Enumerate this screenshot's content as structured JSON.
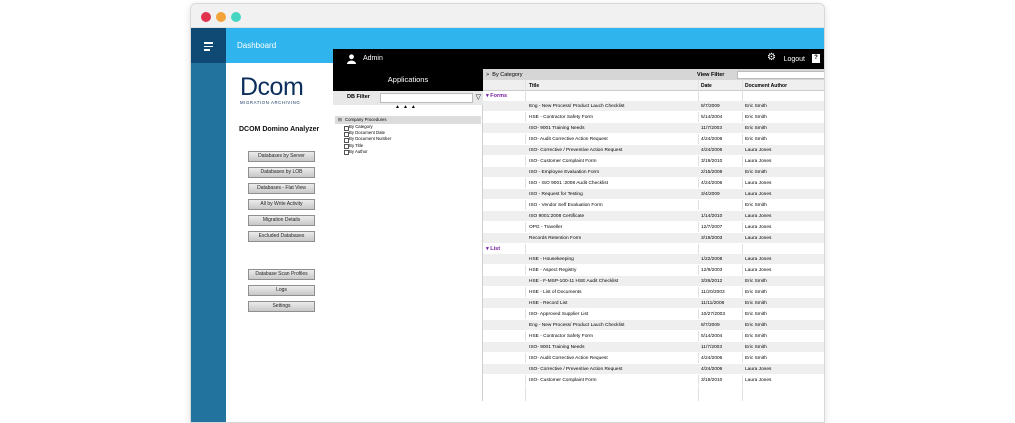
{
  "window": {
    "dots": [
      "#e0334d",
      "#f2a33a",
      "#47d6c1"
    ]
  },
  "topbar": {
    "title": "Dashboard"
  },
  "brand": {
    "logo_text": "Dcom",
    "logo_sub": "MIGRATION ARCHIVING",
    "app_title": "DCOM Domino Analyzer"
  },
  "nav": {
    "group1": [
      "Databases by Server",
      "Databases by LOB",
      "Databases - Flat View",
      "All by Write Activity",
      "Migration Details",
      "Excluded Databases"
    ],
    "group2": [
      "Database Scan Profiles",
      "Logs",
      "Settings"
    ]
  },
  "header": {
    "user": "Admin",
    "logout": "Logout",
    "help": "?"
  },
  "applications": {
    "title": "Applications",
    "db_filter_label": "DB Filter",
    "tree_root": "Company Procedures",
    "tree_items": [
      "By Category",
      "By Document Date",
      "By Document Number",
      "By Title",
      "By Author"
    ]
  },
  "view": {
    "breadcrumb": "By Category",
    "view_filter_label": "View Filter",
    "columns": {
      "title": "Title",
      "date": "Date",
      "author": "Document Author"
    },
    "categories": [
      {
        "name": "Forms",
        "rows": [
          [
            "Eng - New Process/ Product Lauch Checklist",
            "8/7/2009",
            "Eric Smith"
          ],
          [
            "HSE - Contractor Safety Form",
            "5/14/2004",
            "Eric Smith"
          ],
          [
            "ISO- 9001 Training Needs",
            "11/7/2003",
            "Eric Smith"
          ],
          [
            "ISO- Audit Corrective Action Request",
            "4/24/2006",
            "Eric Smith"
          ],
          [
            "ISO- Corrective / Preventive Action Request",
            "4/24/2006",
            "Laura Jones"
          ],
          [
            "ISO- Customer Complaint Form",
            "3/19/2010",
            "Laura Jones"
          ],
          [
            "ISO - Employee Evaluation Form",
            "2/15/2008",
            "Eric Smith"
          ],
          [
            "ISO - ISO 9001 :2008 Audit Checklist",
            "4/24/2006",
            "Laura Jones"
          ],
          [
            "ISO - Request for Testing",
            "3/4/2009",
            "Laura Jones"
          ],
          [
            "ISO - Vendor Self Evaluation Form",
            "",
            "Eric Smith"
          ],
          [
            "ISO 9001:2008 Certificate",
            "1/14/2010",
            "Laura Jones"
          ],
          [
            "OPG - Traveller",
            "12/7/2007",
            "Laura Jones"
          ],
          [
            "Records Retention Form",
            "3/19/2003",
            "Laura Jones"
          ]
        ]
      },
      {
        "name": "List",
        "rows": [
          [
            "HSE - Housekeeping",
            "1/22/2008",
            "Laura Jones"
          ],
          [
            "HSE - Aspect Registry",
            "12/9/2003",
            "Laura Jones"
          ],
          [
            "HSE - F-MSP-100-11 HSE Audit Checklist",
            "3/26/2012",
            "Eric Smith"
          ],
          [
            "HSE - List of Documents",
            "11/20/2003",
            "Eric Smith"
          ],
          [
            "HSE - Record List",
            "11/11/2006",
            "Eric Smith"
          ],
          [
            "ISO- Approved Supplier List",
            "10/27/2003",
            "Eric Smith"
          ],
          [
            "Eng - New Process/ Product Lauch Checklist",
            "8/7/2009",
            "Eric Smith"
          ],
          [
            "HSE - Contractor Safety Form",
            "5/14/2004",
            "Eric Smith"
          ],
          [
            "ISO- 9001 Training Needs",
            "11/7/2003",
            "Eric Smith"
          ],
          [
            "ISO- Audit Corrective Action Request",
            "4/24/2006",
            "Eric Smith"
          ],
          [
            "ISO- Corrective / Preventive Action Request",
            "4/24/2006",
            "Laura Jones"
          ],
          [
            "ISO- Customer Complaint Form",
            "3/19/2010",
            "Laura Jones"
          ]
        ]
      }
    ]
  }
}
